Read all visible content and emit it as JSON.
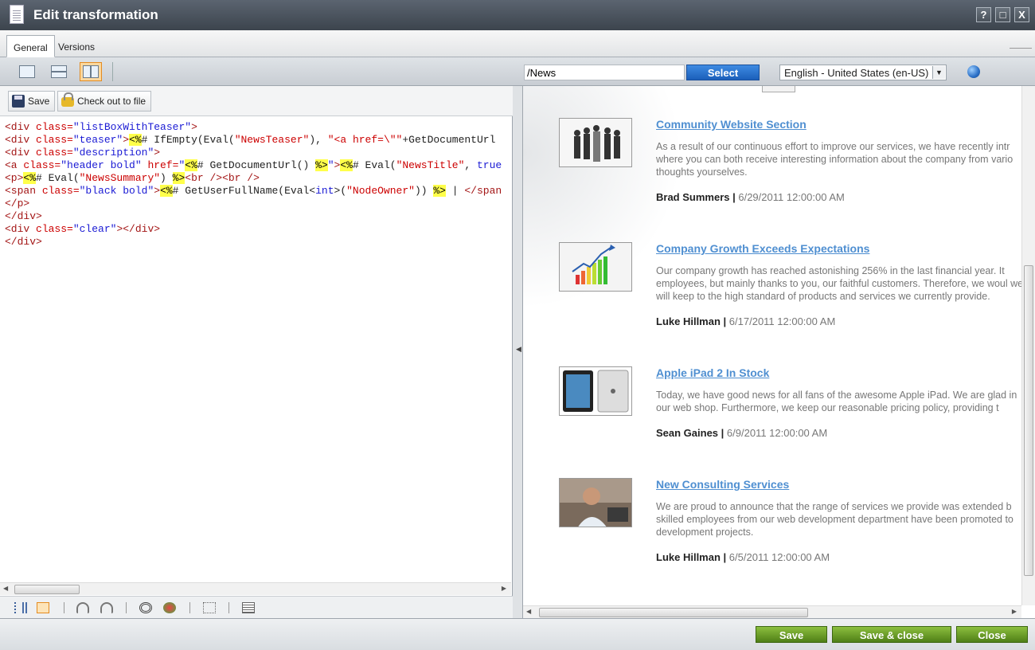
{
  "window": {
    "title": "Edit transformation",
    "controls": [
      "?",
      "□",
      "X"
    ]
  },
  "tabs": [
    {
      "label": "General",
      "active": true
    },
    {
      "label": "Versions",
      "active": false
    }
  ],
  "toolbar": {
    "layout_buttons": [
      "single-pane-icon",
      "horizontal-split-icon",
      "vertical-split-icon"
    ],
    "path_value": "/News",
    "select_label": "Select",
    "language_value": "English - United States (en-US)"
  },
  "editor": {
    "save_label": "Save",
    "checkout_label": "Check out to file"
  },
  "preview": {
    "items": [
      {
        "title": "Community Website Section",
        "teaser": "As a result of our continuous effort to improve our services, we have recently intr where you can both receive interesting information about the company from vario thoughts yourselves.",
        "author": "Brad Summers",
        "date": "6/29/2011 12:00:00 AM"
      },
      {
        "title": "Company Growth Exceeds Expectations",
        "teaser": "Our company growth has reached astonishing 256% in the last financial year. It employees, but mainly thanks to you, our faithful customers. Therefore, we woul we will keep to the high standard of products and services we currently provide.",
        "author": "Luke Hillman",
        "date": "6/17/2011 12:00:00 AM"
      },
      {
        "title": "Apple iPad 2 In Stock",
        "teaser": "Today, we have good news for all fans of the awesome Apple iPad. We are glad in our web shop. Furthermore, we keep our reasonable pricing policy, providing t",
        "author": "Sean Gaines",
        "date": "6/9/2011 12:00:00 AM"
      },
      {
        "title": "New Consulting Services",
        "teaser": "We are proud to announce that the range of services we provide was extended b skilled employees from our web development department have been promoted to development projects.",
        "author": "Luke Hillman",
        "date": "6/5/2011 12:00:00 AM"
      }
    ]
  },
  "footer": {
    "save_label": "Save",
    "save_close_label": "Save & close",
    "close_label": "Close"
  },
  "colors": {
    "accent_green": "#6a9e2a",
    "link_blue": "#4f8fd1",
    "select_blue": "#2a74d0",
    "highlight": "#ffff4a"
  }
}
